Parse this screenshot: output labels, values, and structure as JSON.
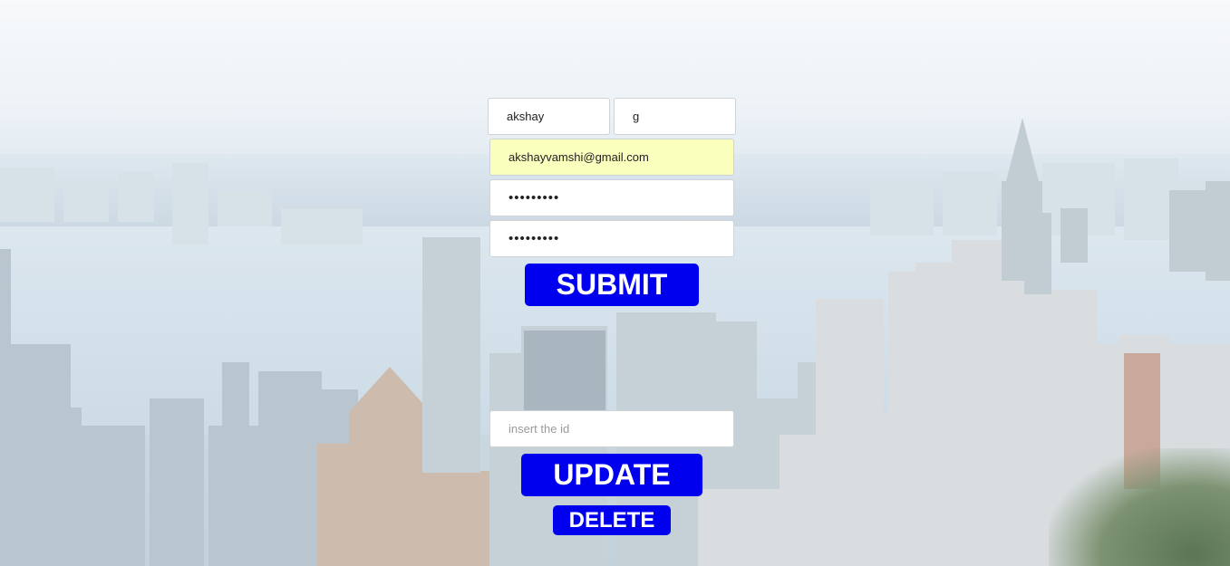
{
  "form": {
    "first_name": {
      "value": "akshay"
    },
    "last_name": {
      "value": "g"
    },
    "email": {
      "value": "akshayvamshi@gmail.com"
    },
    "password": {
      "value": "akshay123"
    },
    "confirm_password": {
      "value": "akshay123"
    },
    "submit_label": "SUBMIT"
  },
  "manage": {
    "id_input": {
      "placeholder": "insert the id",
      "value": ""
    },
    "update_label": "UPDATE",
    "delete_label": "DELETE"
  },
  "colors": {
    "button_bg": "#0000ee",
    "button_text": "#ffffff",
    "autofill_bg": "#faffbd"
  }
}
